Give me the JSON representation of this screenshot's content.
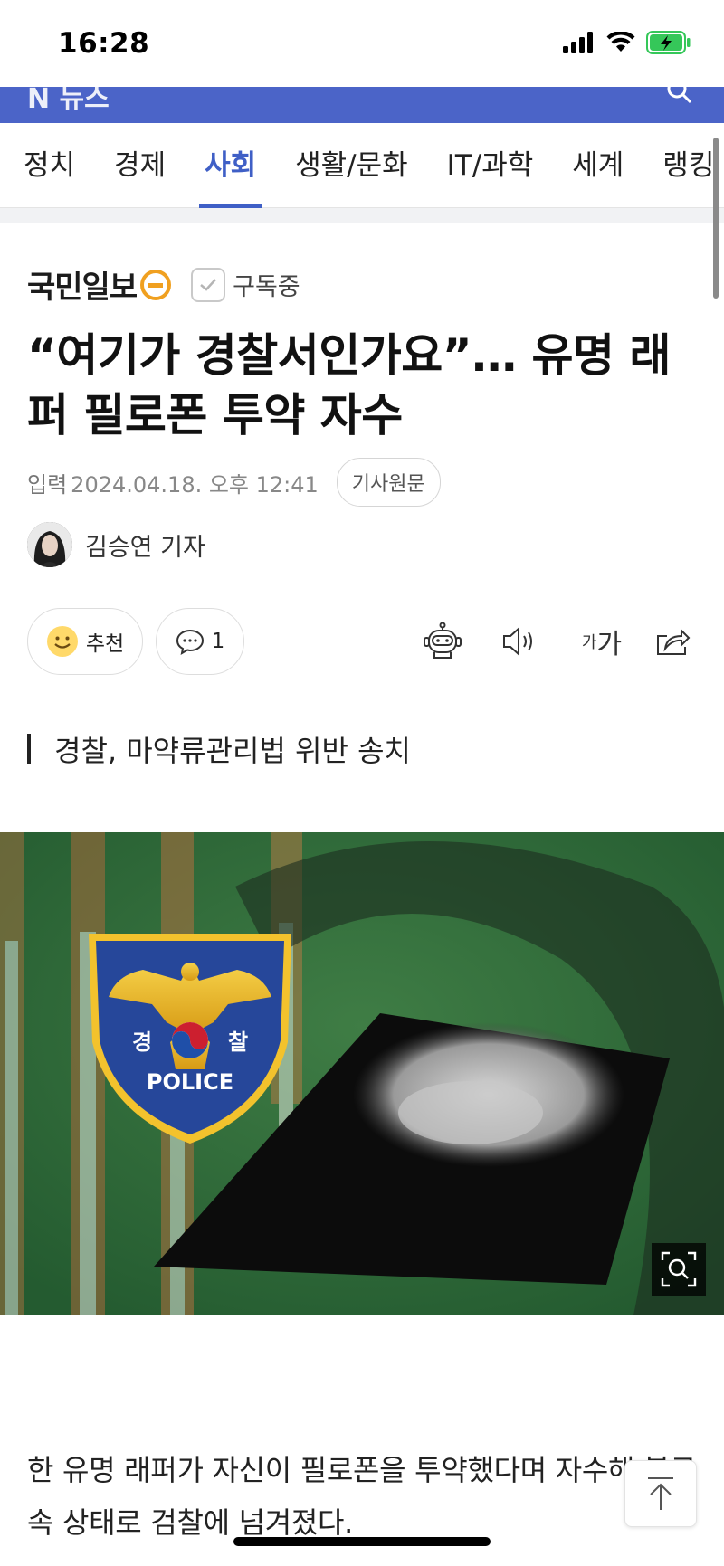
{
  "status_bar": {
    "time": "16:28",
    "icons": [
      "signal-icon",
      "wifi-icon",
      "battery-charging-icon"
    ],
    "battery_color": "#35c759"
  },
  "app_bar": {
    "color": "#4b64c8",
    "logo_ghost": "N 뉴스"
  },
  "tabs": [
    {
      "label": "정치",
      "active": false
    },
    {
      "label": "경제",
      "active": false
    },
    {
      "label": "사회",
      "active": true
    },
    {
      "label": "생활/문화",
      "active": false
    },
    {
      "label": "IT/과학",
      "active": false
    },
    {
      "label": "세계",
      "active": false
    },
    {
      "label": "랭킹",
      "active": false
    }
  ],
  "accent_color": "#3f5fc6",
  "press": {
    "name": "국민일보",
    "subscribe_label": "구독중"
  },
  "article": {
    "headline": "“여기가 경찰서인가요”… 유명 래퍼 필로폰 투약 자수",
    "meta_label": "입력",
    "date": "2024.04.18. 오후 12:41",
    "original_button": "기사원문",
    "reporter": "김승연 기자",
    "subtitle": "경찰, 마약류관리법 위반 송치",
    "body": "한 유명 래퍼가 자신이 필로폰을 투약했다며 자수해 불구속 상태로 검찰에 넘겨졌다."
  },
  "actions": {
    "like_label": "추천",
    "comment_count": "1",
    "font_small": "가",
    "font_big": "가"
  },
  "image": {
    "badge_left": "경",
    "badge_right": "찰",
    "badge_word": "POLICE"
  }
}
